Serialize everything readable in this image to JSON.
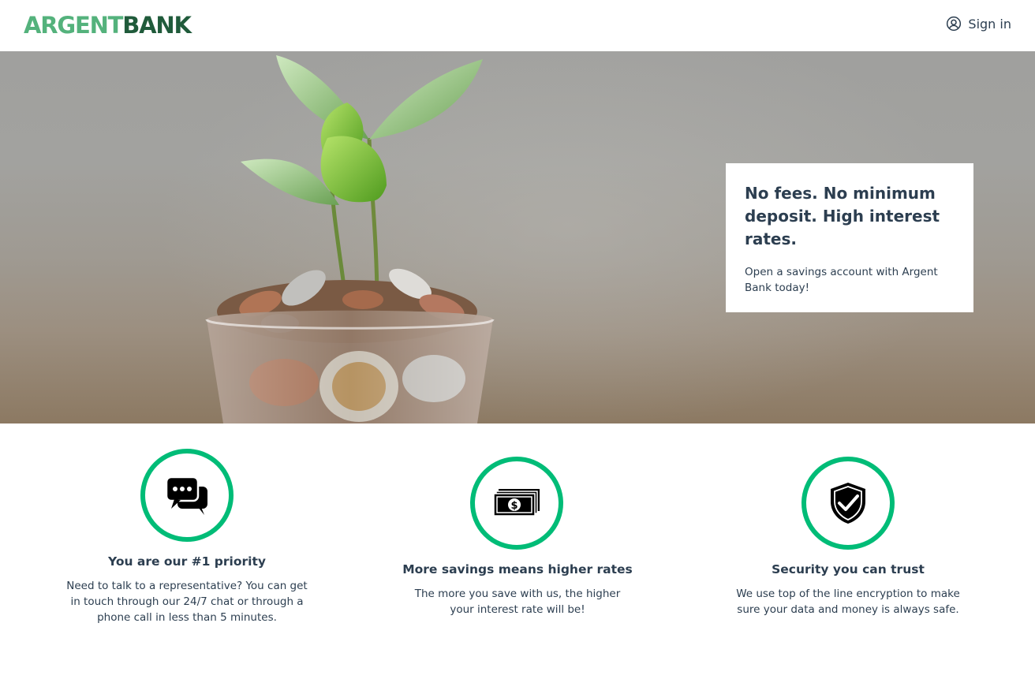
{
  "header": {
    "logo": {
      "part1": "ARGENT",
      "part2": "BANK"
    },
    "signin_label": "Sign in",
    "signin_icon": "user-circle-icon"
  },
  "hero": {
    "title": "No fees. No minimum deposit. High interest rates.",
    "subtitle": "Open a savings account with Argent Bank today!"
  },
  "features": [
    {
      "icon": "chat-icon",
      "title": "You are our #1 priority",
      "text": "Need to talk to a representative? You can get in touch through our 24/7 chat or through a phone call in less than 5 minutes."
    },
    {
      "icon": "money-icon",
      "title": "More savings means higher rates",
      "text": "The more you save with us, the higher your interest rate will be!"
    },
    {
      "icon": "security-shield-icon",
      "title": "Security you can trust",
      "text": "We use top of the line encryption to make sure your data and money is always safe."
    }
  ],
  "colors": {
    "accent": "#00bc77",
    "logo_light": "#54b27c",
    "logo_dark": "#205b3b",
    "text": "#2c3e50"
  }
}
